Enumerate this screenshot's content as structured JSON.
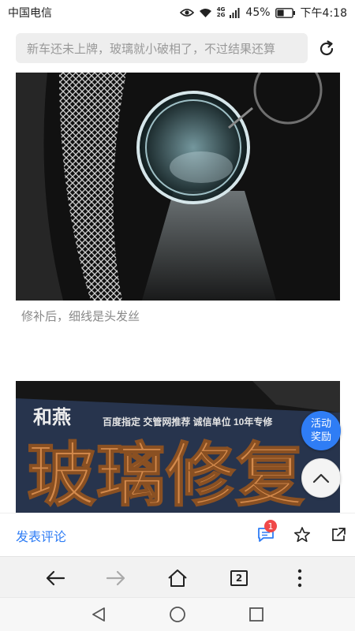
{
  "status_bar": {
    "carrier": "中国电信",
    "network_top": "4G",
    "network_bottom": "2G",
    "battery_percent": "45%",
    "battery_level": 0.45,
    "time": "下午4:18"
  },
  "url_bar": {
    "text": "新车还未上牌，玻璃就小破相了，不过结果还算"
  },
  "article": {
    "caption_1": "修补后，细线是头发丝",
    "sign_text_small": "和燕",
    "sign_text_sub": "百度指定  交管网推荐  诚信单位 10年专修",
    "sign_text_large": "玻璃修复"
  },
  "floating": {
    "promo_line1": "活动",
    "promo_line2": "奖励"
  },
  "comment_bar": {
    "comment_label": "发表评论",
    "comment_count": "1"
  },
  "browser_toolbar": {
    "tab_count": "2"
  },
  "colors": {
    "accent": "#2f7df5",
    "badge": "#f04848"
  }
}
